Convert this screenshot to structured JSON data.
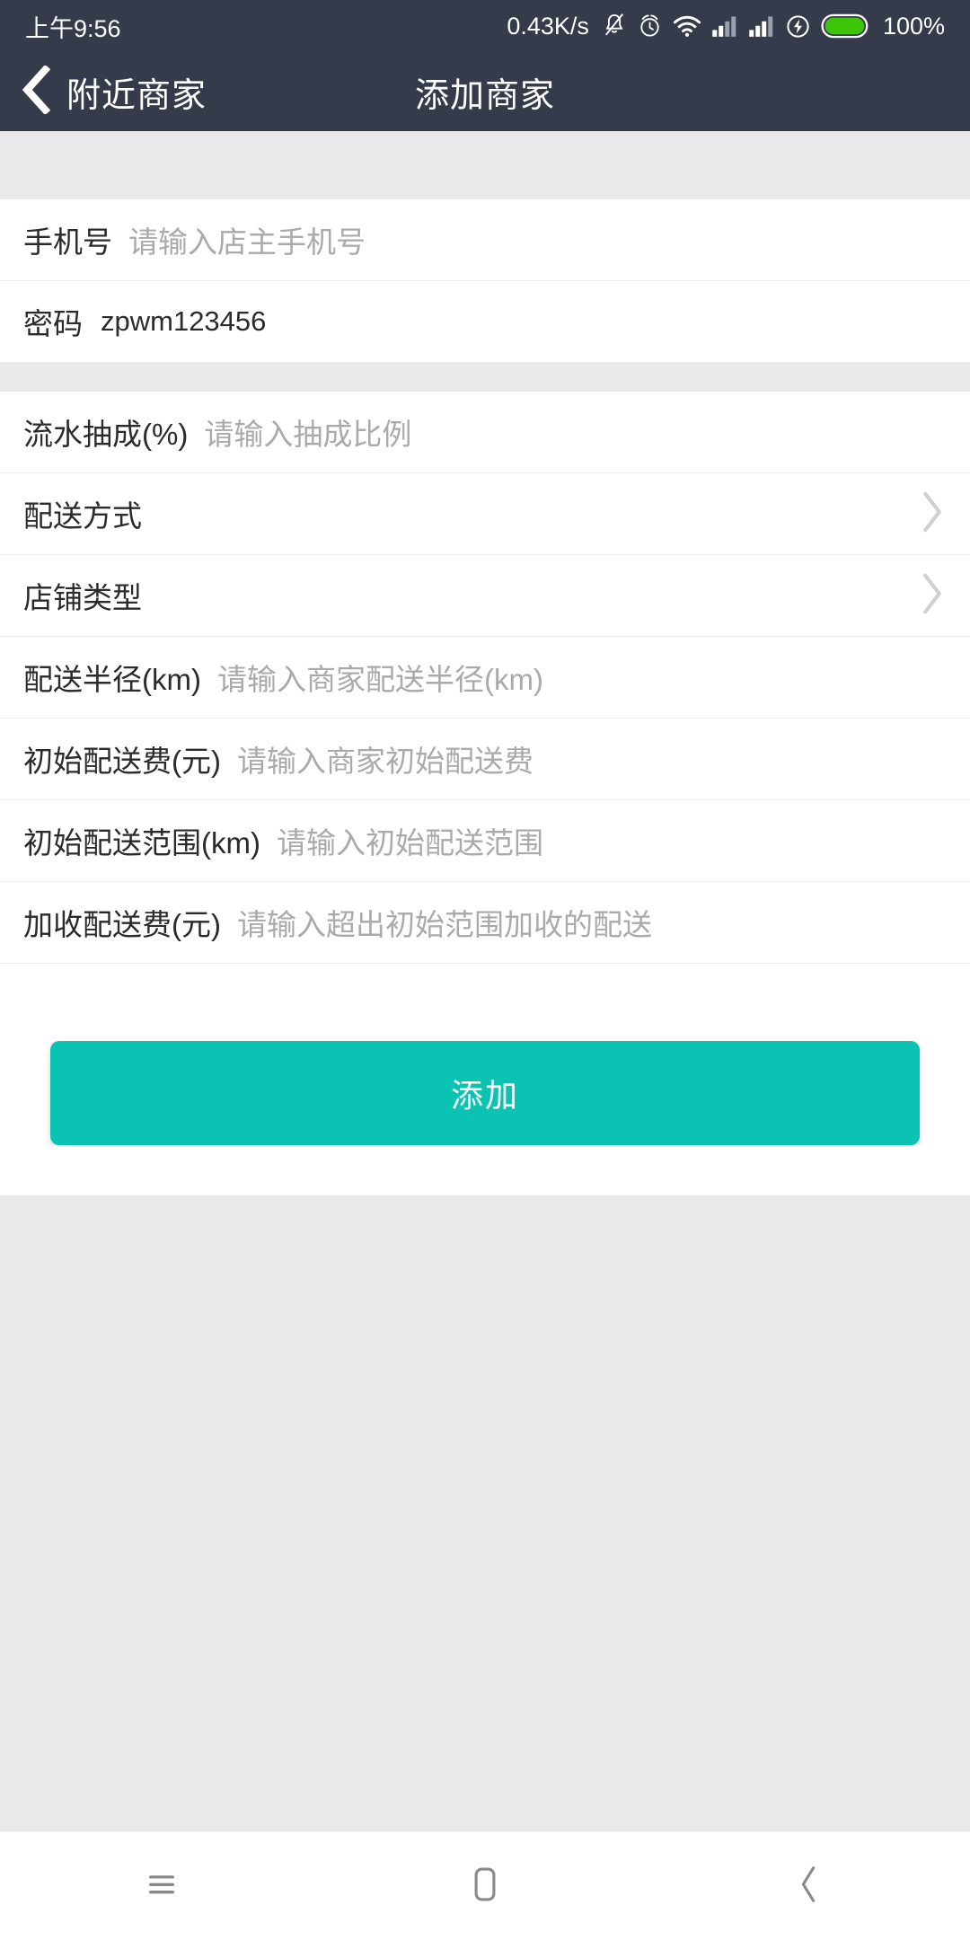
{
  "status_bar": {
    "time": "上午9:56",
    "net_speed": "0.43K/s",
    "battery_percent": "100%",
    "icons": [
      "mute-bell-icon",
      "alarm-clock-icon",
      "wifi-icon",
      "signal-bars-icon-1",
      "signal-bars-icon-2",
      "charging-bolt-icon",
      "battery-icon"
    ],
    "colors": {
      "bar_bg": "#353b4a",
      "battery_fill": "#3ec50a",
      "text": "#ffffff"
    }
  },
  "nav": {
    "back_label": "附近商家",
    "title": "添加商家",
    "back_icon": "chevron-left-icon",
    "bg_color": "#353b4a"
  },
  "form": {
    "groups": [
      {
        "rows": [
          {
            "label": "手机号",
            "placeholder": "请输入店主手机号",
            "value": "",
            "type": "input",
            "name": "phone"
          },
          {
            "label": "密码",
            "placeholder": "",
            "value": "zpwm123456",
            "type": "input",
            "name": "password"
          }
        ]
      },
      {
        "rows": [
          {
            "label": "流水抽成(%)",
            "placeholder": "请输入抽成比例",
            "value": "",
            "type": "input",
            "name": "commission-rate"
          },
          {
            "label": "配送方式",
            "placeholder": "",
            "value": "",
            "type": "select",
            "name": "delivery-method"
          },
          {
            "label": "店铺类型",
            "placeholder": "",
            "value": "",
            "type": "select",
            "name": "shop-type"
          },
          {
            "label": "配送半径(km)",
            "placeholder": "请输入商家配送半径(km)",
            "value": "",
            "type": "input",
            "name": "delivery-radius"
          },
          {
            "label": "初始配送费(元)",
            "placeholder": "请输入商家初始配送费",
            "value": "",
            "type": "input",
            "name": "initial-delivery-fee"
          },
          {
            "label": "初始配送范围(km)",
            "placeholder": "请输入初始配送范围",
            "value": "",
            "type": "input",
            "name": "initial-delivery-range"
          },
          {
            "label": "加收配送费(元)",
            "placeholder": "请输入超出初始范围加收的配送",
            "value": "",
            "type": "input",
            "name": "extra-delivery-fee"
          }
        ]
      }
    ]
  },
  "submit": {
    "label": "添加",
    "color": "#0ac3b2"
  },
  "bottom_nav": {
    "items": [
      {
        "name": "menu-icon",
        "label": "菜单"
      },
      {
        "name": "home-icon",
        "label": "主页"
      },
      {
        "name": "back-icon",
        "label": "返回"
      }
    ],
    "icon_color": "#8a8a8a"
  }
}
